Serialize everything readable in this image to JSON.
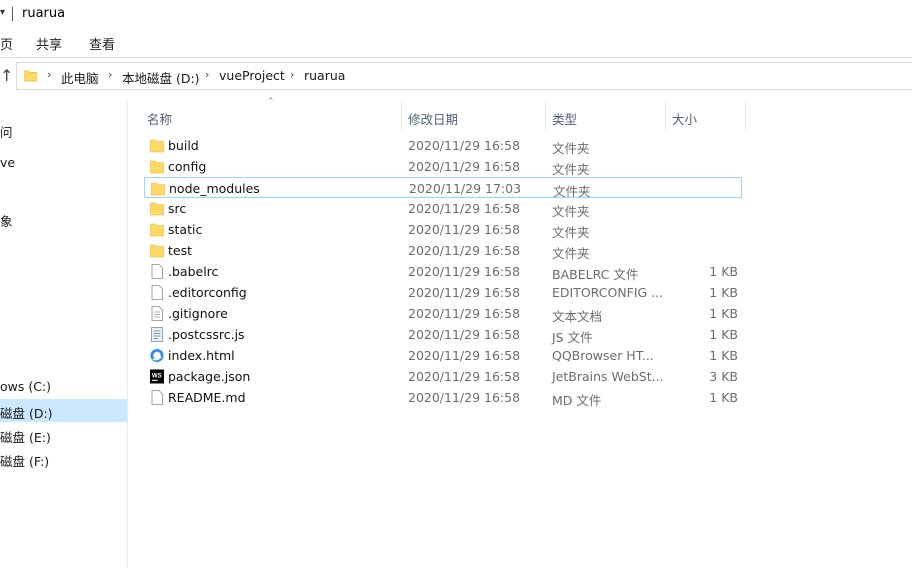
{
  "window": {
    "title": "ruarua"
  },
  "ribbon": {
    "tabs": [
      "页",
      "共享",
      "查看"
    ]
  },
  "address": {
    "crumbs": [
      "此电脑",
      "本地磁盘 (D:)",
      "vueProject",
      "ruarua"
    ]
  },
  "nav": {
    "items": [
      {
        "label": "问",
        "selected": false
      },
      {
        "label": "ve",
        "selected": false
      },
      {
        "label": "象",
        "selected": false
      },
      {
        "label": "ows (C:)",
        "selected": false
      },
      {
        "label": "磁盘 (D:)",
        "selected": true
      },
      {
        "label": "磁盘 (E:)",
        "selected": false
      },
      {
        "label": "磁盘 (F:)",
        "selected": false
      }
    ]
  },
  "columns": {
    "name": "名称",
    "date": "修改日期",
    "type": "类型",
    "size": "大小"
  },
  "files": [
    {
      "name": "build",
      "date": "2020/11/29 16:58",
      "type": "文件夹",
      "size": "",
      "icon": "folder-icon"
    },
    {
      "name": "config",
      "date": "2020/11/29 16:58",
      "type": "文件夹",
      "size": "",
      "icon": "folder-icon"
    },
    {
      "name": "node_modules",
      "date": "2020/11/29 17:03",
      "type": "文件夹",
      "size": "",
      "icon": "folder-icon",
      "focused": true
    },
    {
      "name": "src",
      "date": "2020/11/29 16:58",
      "type": "文件夹",
      "size": "",
      "icon": "folder-icon"
    },
    {
      "name": "static",
      "date": "2020/11/29 16:58",
      "type": "文件夹",
      "size": "",
      "icon": "folder-icon"
    },
    {
      "name": "test",
      "date": "2020/11/29 16:58",
      "type": "文件夹",
      "size": "",
      "icon": "folder-icon"
    },
    {
      "name": ".babelrc",
      "date": "2020/11/29 16:58",
      "type": "BABELRC 文件",
      "size": "1 KB",
      "icon": "file-icon"
    },
    {
      "name": ".editorconfig",
      "date": "2020/11/29 16:58",
      "type": "EDITORCONFIG ...",
      "size": "1 KB",
      "icon": "file-icon"
    },
    {
      "name": ".gitignore",
      "date": "2020/11/29 16:58",
      "type": "文本文档",
      "size": "1 KB",
      "icon": "text-file-icon"
    },
    {
      "name": ".postcssrc.js",
      "date": "2020/11/29 16:58",
      "type": "JS 文件",
      "size": "1 KB",
      "icon": "js-file-icon"
    },
    {
      "name": "index.html",
      "date": "2020/11/29 16:58",
      "type": "QQBrowser HT...",
      "size": "1 KB",
      "icon": "qqbrowser-html-icon"
    },
    {
      "name": "package.json",
      "date": "2020/11/29 16:58",
      "type": "JetBrains WebSt...",
      "size": "3 KB",
      "icon": "webstorm-icon"
    },
    {
      "name": "README.md",
      "date": "2020/11/29 16:58",
      "type": "MD 文件",
      "size": "1 KB",
      "icon": "file-icon"
    }
  ],
  "colors": {
    "folder": "#ffd866",
    "selection": "#cce8ff",
    "focus_border": "#99d1ff",
    "header_text": "#4c607a"
  }
}
